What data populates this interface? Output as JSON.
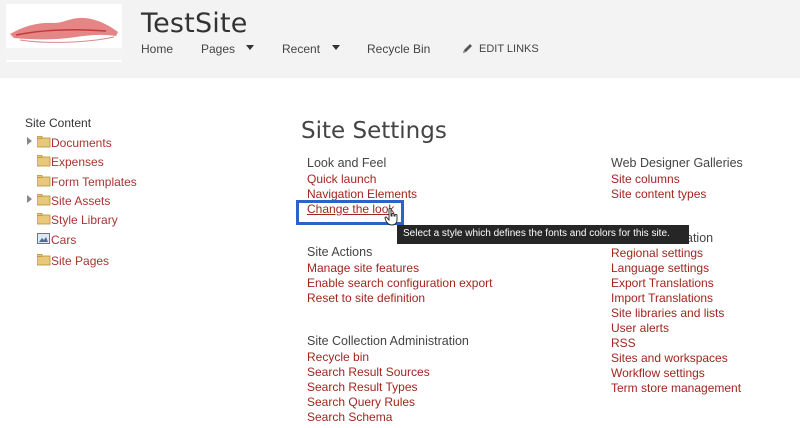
{
  "header": {
    "site_title": "TestSite",
    "nav": [
      {
        "label": "Home",
        "has_caret": false
      },
      {
        "label": "Pages",
        "has_caret": true
      },
      {
        "label": "Recent",
        "has_caret": true
      },
      {
        "label": "Recycle Bin",
        "has_caret": false
      }
    ],
    "edit_links_label": "EDIT LINKS",
    "edit_icon": "pencil-icon"
  },
  "leftnav": {
    "title": "Site Content",
    "items": [
      {
        "label": "Documents",
        "icon": "folder-icon",
        "expandable": true
      },
      {
        "label": "Expenses",
        "icon": "folder-icon",
        "expandable": false
      },
      {
        "label": "Form Templates",
        "icon": "folder-icon",
        "expandable": false
      },
      {
        "label": "Site Assets",
        "icon": "folder-icon",
        "expandable": true
      },
      {
        "label": "Style Library",
        "icon": "folder-icon",
        "expandable": false
      },
      {
        "label": "Cars",
        "icon": "picture-library-icon",
        "expandable": false
      },
      {
        "label": "Site Pages",
        "icon": "folder-icon",
        "expandable": false
      }
    ]
  },
  "main": {
    "page_title": "Site Settings",
    "groups": {
      "look_and_feel": {
        "title": "Look and Feel",
        "links": [
          "Quick launch",
          "Navigation Elements",
          "Change the look"
        ]
      },
      "site_actions": {
        "title": "Site Actions",
        "links": [
          "Manage site features",
          "Enable search configuration export",
          "Reset to site definition"
        ]
      },
      "site_collection_admin": {
        "title": "Site Collection Administration",
        "links": [
          "Recycle bin",
          "Search Result Sources",
          "Search Result Types",
          "Search Query Rules",
          "Search Schema"
        ]
      },
      "web_designer_galleries": {
        "title": "Web Designer Galleries",
        "links": [
          "Site columns",
          "Site content types"
        ]
      },
      "site_administration": {
        "title_visible_fragment": "ation",
        "links": [
          "Regional settings",
          "Language settings",
          "Export Translations",
          "Import Translations",
          "Site libraries and lists",
          "User alerts",
          "RSS",
          "Sites and workspaces",
          "Workflow settings",
          "Term store management"
        ]
      }
    },
    "tooltip": "Select a style which defines the fonts and colors for this site."
  },
  "colors": {
    "link": "#a1261f",
    "header_bg": "#f3f3f3",
    "focus_border": "#2b64c4",
    "tooltip_bg": "#262626"
  }
}
